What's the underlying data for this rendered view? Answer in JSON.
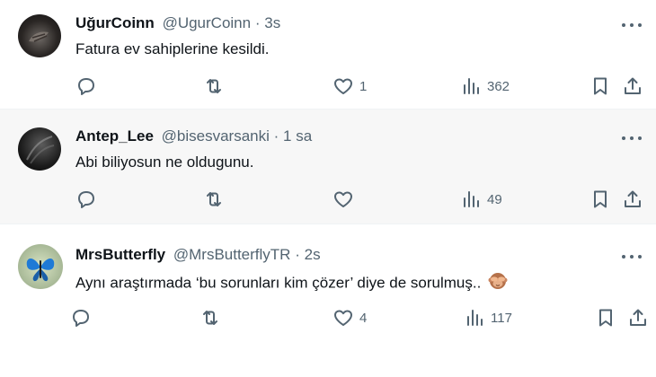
{
  "tweets": [
    {
      "name": "UğurCoinn",
      "handle": "@UgurCoinn",
      "separator": "·",
      "time": "3s",
      "text": "Fatura ev sahiplerine kesildi.",
      "reply_count": "",
      "retweet_count": "",
      "like_count": "1",
      "view_count": "362"
    },
    {
      "name": "Antep_Lee",
      "handle": "@bisesvarsanki",
      "separator": "·",
      "time": "1 sa",
      "text": "Abi biliyosun ne oldugunu.",
      "reply_count": "",
      "retweet_count": "",
      "like_count": "",
      "view_count": "49"
    },
    {
      "name": "MrsButterfly",
      "handle": "@MrsButterflyTR",
      "separator": "·",
      "time": "2s",
      "text": "Aynı araştırmada ‘bu sorunları kim çözer’ diye de sorulmuş..",
      "reply_count": "",
      "retweet_count": "",
      "like_count": "4",
      "view_count": "117"
    }
  ],
  "colors": {
    "text": "#0f1419",
    "secondary": "#536471",
    "divider": "#eff3f4",
    "highlight_bg": "#f7f7f7"
  },
  "icons": [
    "reply-icon",
    "retweet-icon",
    "like-icon",
    "views-icon",
    "bookmark-icon",
    "share-icon",
    "more-icon",
    "see-no-evil-monkey-emoji"
  ]
}
